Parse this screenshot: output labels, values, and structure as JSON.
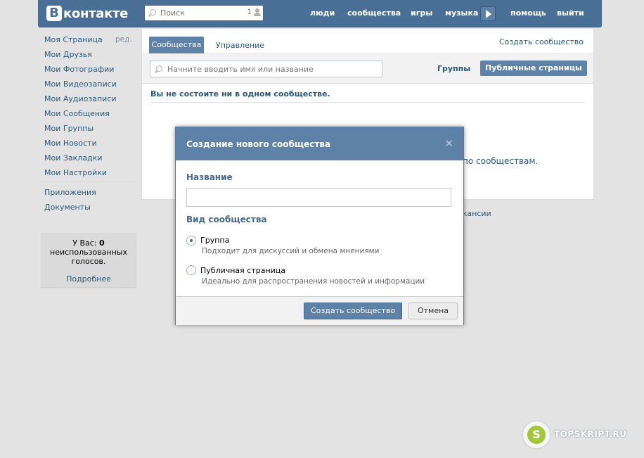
{
  "header": {
    "logo_letter": "В",
    "logo_text": "контакте",
    "search_placeholder": "Поиск",
    "search_count": "1",
    "nav": [
      "люди",
      "сообщества",
      "игры",
      "музыка",
      "помощь",
      "выйти"
    ]
  },
  "leftmenu": {
    "items": [
      "Моя Страница",
      "Мои Друзья",
      "Мои Фотографии",
      "Мои Видеозаписи",
      "Мои Аудиозаписи",
      "Мои Сообщения",
      "Мои Группы",
      "Мои Новости",
      "Мои Закладки",
      "Мои Настройки"
    ],
    "edit": "ред.",
    "extra": [
      "Приложения",
      "Документы"
    ],
    "votes_prefix": "У Вас:",
    "votes_count": "0",
    "votes_suffix": "неиспользованных голосов.",
    "votes_more": "Подробнее"
  },
  "main": {
    "tab_communities": "Сообщества",
    "tab_manage": "Управление",
    "create_link": "Создать сообщество",
    "search_placeholder": "Начните вводить имя или название",
    "filter_groups": "Группы",
    "filter_public": "Публичные страницы",
    "no_groups": "Вы не состоите ни в одном сообществе.",
    "behind_text": "по сообществам.",
    "behind_text2": "акансии"
  },
  "modal": {
    "title": "Создание нового сообщества",
    "close": "✕",
    "name_label": "Название",
    "name_value": "",
    "type_label": "Вид сообщества",
    "options": [
      {
        "label": "Группа",
        "desc": "Подходит для дискуссий и обмена мнениями",
        "selected": true
      },
      {
        "label": "Публичная страница",
        "desc": "Идеально для распространения новостей и информации",
        "selected": false
      }
    ],
    "create_button": "Создать сообщество",
    "cancel_button": "Отмена"
  },
  "watermark": {
    "letter": "S",
    "text": "TOPSKRIPT.RU",
    "sub": "..."
  },
  "colors": {
    "header": "#4a6f96",
    "accent": "#5d81a7",
    "link": "#2b587a",
    "background": "#e3e3e3"
  }
}
